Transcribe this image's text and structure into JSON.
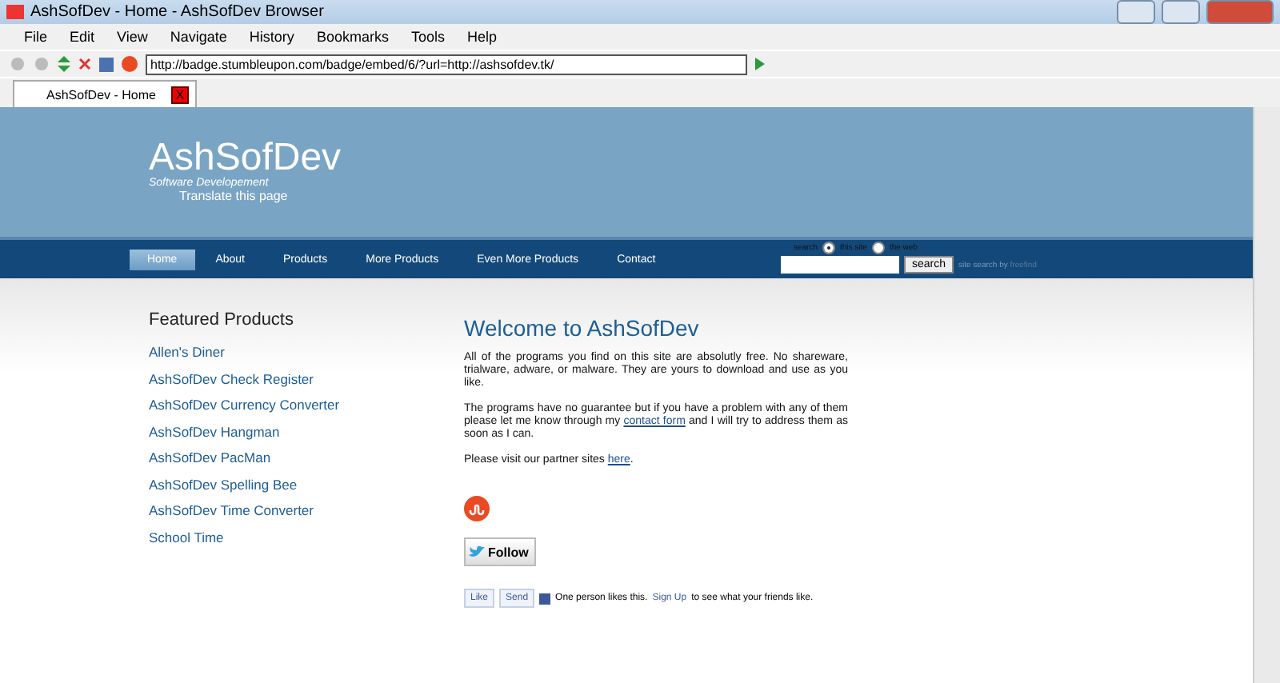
{
  "window": {
    "title": "AshSofDev - Home - AshSofDev Browser"
  },
  "menu": [
    "File",
    "Edit",
    "View",
    "Navigate",
    "History",
    "Bookmarks",
    "Tools",
    "Help"
  ],
  "address": {
    "value": "http://badge.stumbleupon.com/badge/embed/6/?url=http://ashsofdev.tk/"
  },
  "tabs": [
    {
      "label": "AshSofDev - Home",
      "selected": true,
      "close": "X"
    }
  ],
  "site": {
    "title": "AshSofDev",
    "subtitle": "Software Developement",
    "translate": "Translate this page",
    "nav": [
      {
        "label": "Home",
        "selected": true
      },
      {
        "label": "About",
        "selected": false
      },
      {
        "label": "Products",
        "selected": false
      },
      {
        "label": "More Products",
        "selected": false
      },
      {
        "label": "Even More Products",
        "selected": false
      },
      {
        "label": "Contact",
        "selected": false
      }
    ],
    "search": {
      "label": "search",
      "options": [
        {
          "label": "this site",
          "selected": true
        },
        {
          "label": "the web",
          "selected": false
        }
      ],
      "button": "search",
      "credit": "site search by",
      "credit_link": "freefind"
    },
    "sidebar": {
      "heading": "Featured Products",
      "items": [
        "Allen's Diner",
        "AshSofDev Check Register",
        "AshSofDev Currency Converter",
        "AshSofDev Hangman",
        "AshSofDev PacMan",
        "AshSofDev Spelling Bee",
        "AshSofDev Time Converter",
        "School Time"
      ]
    },
    "main": {
      "heading": "Welcome to AshSofDev",
      "paragraphs": [
        {
          "before": "All of the programs you find on this site are absolutly free. No shareware, trialware, adware, or malware. They are yours to download and use as you like."
        },
        {
          "before": "The programs have no guarantee but if you have a problem with any of them please let me know through my ",
          "link": "contact form",
          "after": " and I will try to address them as soon as I can."
        },
        {
          "before": "Please visit our partner sites ",
          "link": "here",
          "after": "."
        }
      ],
      "follow": "Follow",
      "like": "Like",
      "send": "Send",
      "social_before": "One person likes this.",
      "signup": "Sign Up",
      "social_after": "to see what your friends like."
    }
  }
}
